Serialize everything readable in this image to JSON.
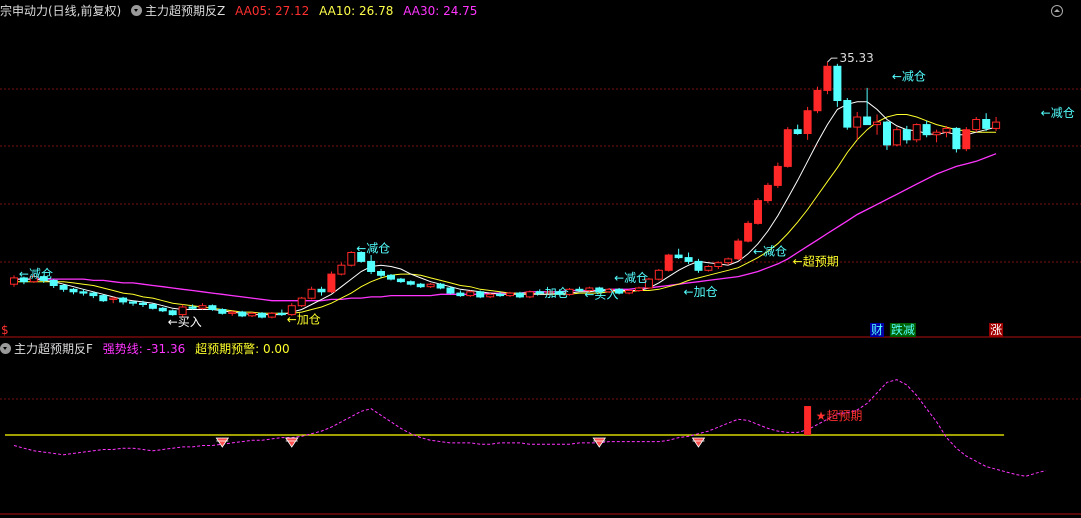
{
  "main_header": {
    "stock": "宗申动力(日线,前复权)",
    "indicator": "主力超预期反Z",
    "ma5": "AA05: 27.12",
    "ma10": "AA10: 26.78",
    "ma30": "AA30: 24.75"
  },
  "sub_header": {
    "indicator": "主力超预期反F",
    "strong_line": "强势线: -31.36",
    "warning": "超预期预警: 0.00"
  },
  "colors": {
    "up": "#ff2828",
    "down": "#54ffff",
    "ma5": "#ffffff",
    "ma10": "#ffff2c",
    "ma30": "#ff35ff",
    "warn": "#ffff00",
    "annot": "#54ffff"
  },
  "price_marker": "$",
  "chart_data": [
    {
      "type": "candlestick",
      "ylim": [
        14.5,
        38.5
      ],
      "max_label": "35.33",
      "candles": [
        [
          17.8,
          18.5,
          17.6,
          18.3
        ],
        [
          18.3,
          18.4,
          17.8,
          18.0
        ],
        [
          18.0,
          18.6,
          17.9,
          18.4
        ],
        [
          18.4,
          18.5,
          17.9,
          18.1
        ],
        [
          18.1,
          18.2,
          17.5,
          17.7
        ],
        [
          17.7,
          17.8,
          17.2,
          17.4
        ],
        [
          17.4,
          17.5,
          17.0,
          17.2
        ],
        [
          17.2,
          17.4,
          16.9,
          17.1
        ],
        [
          17.1,
          17.2,
          16.7,
          16.9
        ],
        [
          16.9,
          17.0,
          16.4,
          16.5
        ],
        [
          16.6,
          16.8,
          16.3,
          16.7
        ],
        [
          16.7,
          16.8,
          16.2,
          16.4
        ],
        [
          16.4,
          16.5,
          16.1,
          16.3
        ],
        [
          16.3,
          16.5,
          16.0,
          16.2
        ],
        [
          16.2,
          16.3,
          15.8,
          15.9
        ],
        [
          15.9,
          16.0,
          15.6,
          15.7
        ],
        [
          15.7,
          15.8,
          15.3,
          15.4
        ],
        [
          15.4,
          16.2,
          15.2,
          16.0
        ],
        [
          16.0,
          16.2,
          15.8,
          15.9
        ],
        [
          15.9,
          16.3,
          15.8,
          16.1
        ],
        [
          16.1,
          16.2,
          15.7,
          15.8
        ],
        [
          15.8,
          15.9,
          15.4,
          15.5
        ],
        [
          15.5,
          15.7,
          15.3,
          15.6
        ],
        [
          15.6,
          15.7,
          15.2,
          15.3
        ],
        [
          15.3,
          15.6,
          15.2,
          15.5
        ],
        [
          15.5,
          15.6,
          15.1,
          15.2
        ],
        [
          15.2,
          15.6,
          15.1,
          15.5
        ],
        [
          15.5,
          15.8,
          15.3,
          15.4
        ],
        [
          15.4,
          16.3,
          15.3,
          16.1
        ],
        [
          16.1,
          16.8,
          16.0,
          16.7
        ],
        [
          16.7,
          17.6,
          16.6,
          17.4
        ],
        [
          17.4,
          17.6,
          16.9,
          17.2
        ],
        [
          17.2,
          18.8,
          17.1,
          18.6
        ],
        [
          18.6,
          19.5,
          18.5,
          19.3
        ],
        [
          19.3,
          20.4,
          19.2,
          20.3
        ],
        [
          20.3,
          20.4,
          19.5,
          19.6
        ],
        [
          19.6,
          20.1,
          18.6,
          18.8
        ],
        [
          18.8,
          19.0,
          18.3,
          18.5
        ],
        [
          18.5,
          18.6,
          18.1,
          18.2
        ],
        [
          18.2,
          18.3,
          17.9,
          18.0
        ],
        [
          18.0,
          18.1,
          17.7,
          17.8
        ],
        [
          17.8,
          17.9,
          17.5,
          17.6
        ],
        [
          17.6,
          17.9,
          17.5,
          17.8
        ],
        [
          17.8,
          17.9,
          17.4,
          17.5
        ],
        [
          17.5,
          17.6,
          17.0,
          17.1
        ],
        [
          17.1,
          17.3,
          16.8,
          16.9
        ],
        [
          16.9,
          17.3,
          16.8,
          17.2
        ],
        [
          17.2,
          17.3,
          16.7,
          16.8
        ],
        [
          16.8,
          17.1,
          16.7,
          17.0
        ],
        [
          17.0,
          17.2,
          16.8,
          16.9
        ],
        [
          16.9,
          17.2,
          16.8,
          17.1
        ],
        [
          17.1,
          17.2,
          16.7,
          16.8
        ],
        [
          16.8,
          17.3,
          16.7,
          17.2
        ],
        [
          17.2,
          17.4,
          17.0,
          17.1
        ],
        [
          17.1,
          17.3,
          17.0,
          17.2
        ],
        [
          17.2,
          17.4,
          16.9,
          17.0
        ],
        [
          17.0,
          17.5,
          16.9,
          17.4
        ],
        [
          17.4,
          17.6,
          17.2,
          17.3
        ],
        [
          17.3,
          17.6,
          17.2,
          17.5
        ],
        [
          17.5,
          17.6,
          17.1,
          17.2
        ],
        [
          17.2,
          17.5,
          17.1,
          17.4
        ],
        [
          17.4,
          17.5,
          17.0,
          17.1
        ],
        [
          17.1,
          17.4,
          17.0,
          17.3
        ],
        [
          17.3,
          17.6,
          17.2,
          17.5
        ],
        [
          17.5,
          18.3,
          17.4,
          18.2
        ],
        [
          18.2,
          19.0,
          18.1,
          18.9
        ],
        [
          18.9,
          20.2,
          18.8,
          20.1
        ],
        [
          20.1,
          20.6,
          19.8,
          19.9
        ],
        [
          19.9,
          20.3,
          19.4,
          19.6
        ],
        [
          19.6,
          19.8,
          18.7,
          18.9
        ],
        [
          18.9,
          19.3,
          18.8,
          19.2
        ],
        [
          19.2,
          19.6,
          19.0,
          19.5
        ],
        [
          19.5,
          19.9,
          19.3,
          19.8
        ],
        [
          19.8,
          21.4,
          19.7,
          21.2
        ],
        [
          21.2,
          22.8,
          21.1,
          22.6
        ],
        [
          22.6,
          24.6,
          22.5,
          24.4
        ],
        [
          24.4,
          25.8,
          24.2,
          25.6
        ],
        [
          25.6,
          27.4,
          25.4,
          27.1
        ],
        [
          27.1,
          30.2,
          27.0,
          30.0
        ],
        [
          30.0,
          30.4,
          29.6,
          29.7
        ],
        [
          29.7,
          31.8,
          29.2,
          31.5
        ],
        [
          31.5,
          33.4,
          31.3,
          33.1
        ],
        [
          33.1,
          35.33,
          32.8,
          35.0
        ],
        [
          35.0,
          35.2,
          31.8,
          32.3
        ],
        [
          32.3,
          32.5,
          30.0,
          30.2
        ],
        [
          30.2,
          31.4,
          29.2,
          31.0
        ],
        [
          31.0,
          33.3,
          30.4,
          30.4
        ],
        [
          30.4,
          31.2,
          29.6,
          30.6
        ],
        [
          30.6,
          30.7,
          28.4,
          28.8
        ],
        [
          28.8,
          30.2,
          28.7,
          30.0
        ],
        [
          30.0,
          30.3,
          28.9,
          29.2
        ],
        [
          29.2,
          30.5,
          29.0,
          30.4
        ],
        [
          30.4,
          30.7,
          29.4,
          29.6
        ],
        [
          29.6,
          30.0,
          29.0,
          29.8
        ],
        [
          29.8,
          30.3,
          29.4,
          30.1
        ],
        [
          30.1,
          30.2,
          28.2,
          28.5
        ],
        [
          28.5,
          30.2,
          28.3,
          30.0
        ],
        [
          30.0,
          31.0,
          29.8,
          30.8
        ],
        [
          30.8,
          31.3,
          29.9,
          30.1
        ],
        [
          30.1,
          31.0,
          29.9,
          30.6
        ]
      ],
      "ma5": [
        18.2,
        18.2,
        18.2,
        18.1,
        18.0,
        17.8,
        17.6,
        17.4,
        17.2,
        17.0,
        16.8,
        16.6,
        16.5,
        16.4,
        16.3,
        16.1,
        15.9,
        15.8,
        15.8,
        15.8,
        15.8,
        15.7,
        15.6,
        15.5,
        15.4,
        15.4,
        15.4,
        15.4,
        15.6,
        15.8,
        16.2,
        16.6,
        17.0,
        17.6,
        18.2,
        18.8,
        19.2,
        19.3,
        19.2,
        19.0,
        18.6,
        18.3,
        18.0,
        17.8,
        17.6,
        17.4,
        17.3,
        17.2,
        17.1,
        17.0,
        17.0,
        17.0,
        17.0,
        17.0,
        17.0,
        17.1,
        17.1,
        17.2,
        17.2,
        17.3,
        17.3,
        17.3,
        17.3,
        17.3,
        17.5,
        17.9,
        18.4,
        18.9,
        19.3,
        19.6,
        19.5,
        19.4,
        19.3,
        19.6,
        20.2,
        21.0,
        22.0,
        23.2,
        24.6,
        26.0,
        27.5,
        29.0,
        30.4,
        31.6,
        32.0,
        32.2,
        32.2,
        31.6,
        30.8,
        30.3,
        30.0,
        29.9,
        29.7,
        29.6,
        29.8,
        29.6,
        29.6,
        29.8,
        30.0,
        30.2
      ],
      "ma10": [
        18.0,
        18.0,
        18.0,
        18.0,
        18.0,
        18.0,
        17.9,
        17.8,
        17.7,
        17.5,
        17.3,
        17.1,
        17.0,
        16.8,
        16.7,
        16.5,
        16.3,
        16.2,
        16.1,
        16.0,
        15.9,
        15.8,
        15.7,
        15.6,
        15.6,
        15.5,
        15.5,
        15.5,
        15.5,
        15.6,
        15.8,
        16.0,
        16.3,
        16.7,
        17.1,
        17.6,
        18.0,
        18.3,
        18.5,
        18.6,
        18.6,
        18.5,
        18.3,
        18.1,
        17.9,
        17.7,
        17.6,
        17.4,
        17.3,
        17.2,
        17.1,
        17.1,
        17.1,
        17.0,
        17.0,
        17.0,
        17.0,
        17.1,
        17.1,
        17.1,
        17.2,
        17.2,
        17.2,
        17.3,
        17.3,
        17.4,
        17.6,
        17.8,
        18.1,
        18.3,
        18.5,
        18.7,
        18.9,
        19.1,
        19.5,
        19.9,
        20.4,
        21.0,
        21.8,
        22.7,
        23.7,
        24.8,
        25.9,
        27.0,
        28.2,
        29.2,
        30.0,
        30.6,
        31.0,
        31.2,
        31.2,
        31.0,
        30.7,
        30.4,
        30.2,
        30.0,
        29.9,
        29.8,
        29.8,
        29.8
      ],
      "ma30": [
        18.2,
        18.2,
        18.2,
        18.2,
        18.2,
        18.2,
        18.2,
        18.2,
        18.1,
        18.1,
        18.0,
        17.9,
        17.9,
        17.8,
        17.7,
        17.6,
        17.5,
        17.4,
        17.3,
        17.2,
        17.1,
        17.0,
        16.9,
        16.8,
        16.7,
        16.6,
        16.5,
        16.5,
        16.5,
        16.5,
        16.5,
        16.5,
        16.6,
        16.6,
        16.7,
        16.7,
        16.8,
        16.8,
        16.9,
        16.9,
        16.9,
        16.9,
        16.9,
        17.0,
        17.0,
        17.0,
        17.0,
        17.0,
        17.1,
        17.1,
        17.1,
        17.1,
        17.2,
        17.2,
        17.2,
        17.2,
        17.3,
        17.3,
        17.3,
        17.3,
        17.4,
        17.4,
        17.4,
        17.5,
        17.5,
        17.6,
        17.7,
        17.8,
        17.9,
        18.0,
        18.1,
        18.2,
        18.3,
        18.4,
        18.6,
        18.8,
        19.1,
        19.4,
        19.8,
        20.3,
        20.8,
        21.3,
        21.8,
        22.3,
        22.8,
        23.3,
        23.7,
        24.1,
        24.5,
        24.9,
        25.3,
        25.7,
        26.1,
        26.5,
        26.8,
        27.1,
        27.3,
        27.5,
        27.8,
        28.1
      ],
      "annotations": [
        {
          "i": 1,
          "price": 18.6,
          "text": "←减仓",
          "color": "#54ffff"
        },
        {
          "i": 16,
          "price": 14.8,
          "text": "←买入",
          "color": "#ffffff"
        },
        {
          "i": 28,
          "price": 15.0,
          "text": "←加仓",
          "color": "#ffff2c"
        },
        {
          "i": 35,
          "price": 20.6,
          "text": "←减仓",
          "color": "#54ffff"
        },
        {
          "i": 53,
          "price": 17.1,
          "text": "←加仓",
          "color": "#54ffff"
        },
        {
          "i": 58,
          "price": 17.0,
          "text": "←买入",
          "color": "#54ffff"
        },
        {
          "i": 61,
          "price": 18.3,
          "text": "←减仓",
          "color": "#54ffff"
        },
        {
          "i": 68,
          "price": 17.2,
          "text": "←加仓",
          "color": "#54ffff"
        },
        {
          "i": 75,
          "price": 20.4,
          "text": "←减仓",
          "color": "#54ffff"
        },
        {
          "i": 79,
          "price": 19.6,
          "text": "←超预期",
          "color": "#ffff2c"
        },
        {
          "i": 89,
          "price": 34.2,
          "text": "←减仓",
          "color": "#54ffff"
        },
        {
          "i": 104,
          "price": 31.3,
          "text": "←减仓",
          "color": "#54ffff"
        }
      ],
      "badges": [
        {
          "i": 87,
          "text": "财",
          "color": "#54ffff",
          "bg": "#0000a8"
        },
        {
          "i": 89,
          "text": "跌减",
          "color": "#54ffff",
          "bg": "#006000"
        },
        {
          "i": 99,
          "text": "涨",
          "color": "#ffffff",
          "bg": "#a00000"
        }
      ]
    },
    {
      "type": "line",
      "ylim": [
        -60,
        60
      ],
      "baseline": 0,
      "strong_line": [
        -8,
        -10,
        -12,
        -13,
        -14,
        -15,
        -14,
        -13,
        -12,
        -11,
        -11,
        -10,
        -10,
        -11,
        -12,
        -11,
        -10,
        -9,
        -9,
        -8,
        -8,
        -7,
        -6,
        -5,
        -4,
        -4,
        -3,
        -2,
        -2,
        -1,
        1,
        3,
        6,
        10,
        14,
        18,
        20,
        15,
        10,
        5,
        1,
        -2,
        -4,
        -5,
        -6,
        -6,
        -6,
        -7,
        -7,
        -6,
        -6,
        -6,
        -7,
        -7,
        -7,
        -7,
        -7,
        -6,
        -6,
        -6,
        -5,
        -5,
        -5,
        -5,
        -5,
        -5,
        -4,
        -2,
        -1,
        1,
        3,
        6,
        9,
        12,
        11,
        8,
        5,
        3,
        2,
        2,
        4,
        8,
        12,
        16,
        17,
        19,
        24,
        32,
        40,
        42,
        38,
        30,
        20,
        10,
        -2,
        -10,
        -16,
        -20,
        -24,
        -26,
        -28,
        -30,
        -31.36,
        -29,
        -27
      ],
      "warnings": [
        {
          "i": 21,
          "icon": "diamond-icon"
        },
        {
          "i": 28,
          "icon": "diamond-icon"
        },
        {
          "i": 59,
          "icon": "diamond-icon"
        },
        {
          "i": 69,
          "icon": "diamond-icon"
        }
      ],
      "signal": {
        "i": 80,
        "value": 22,
        "text": "★超预期"
      }
    }
  ]
}
